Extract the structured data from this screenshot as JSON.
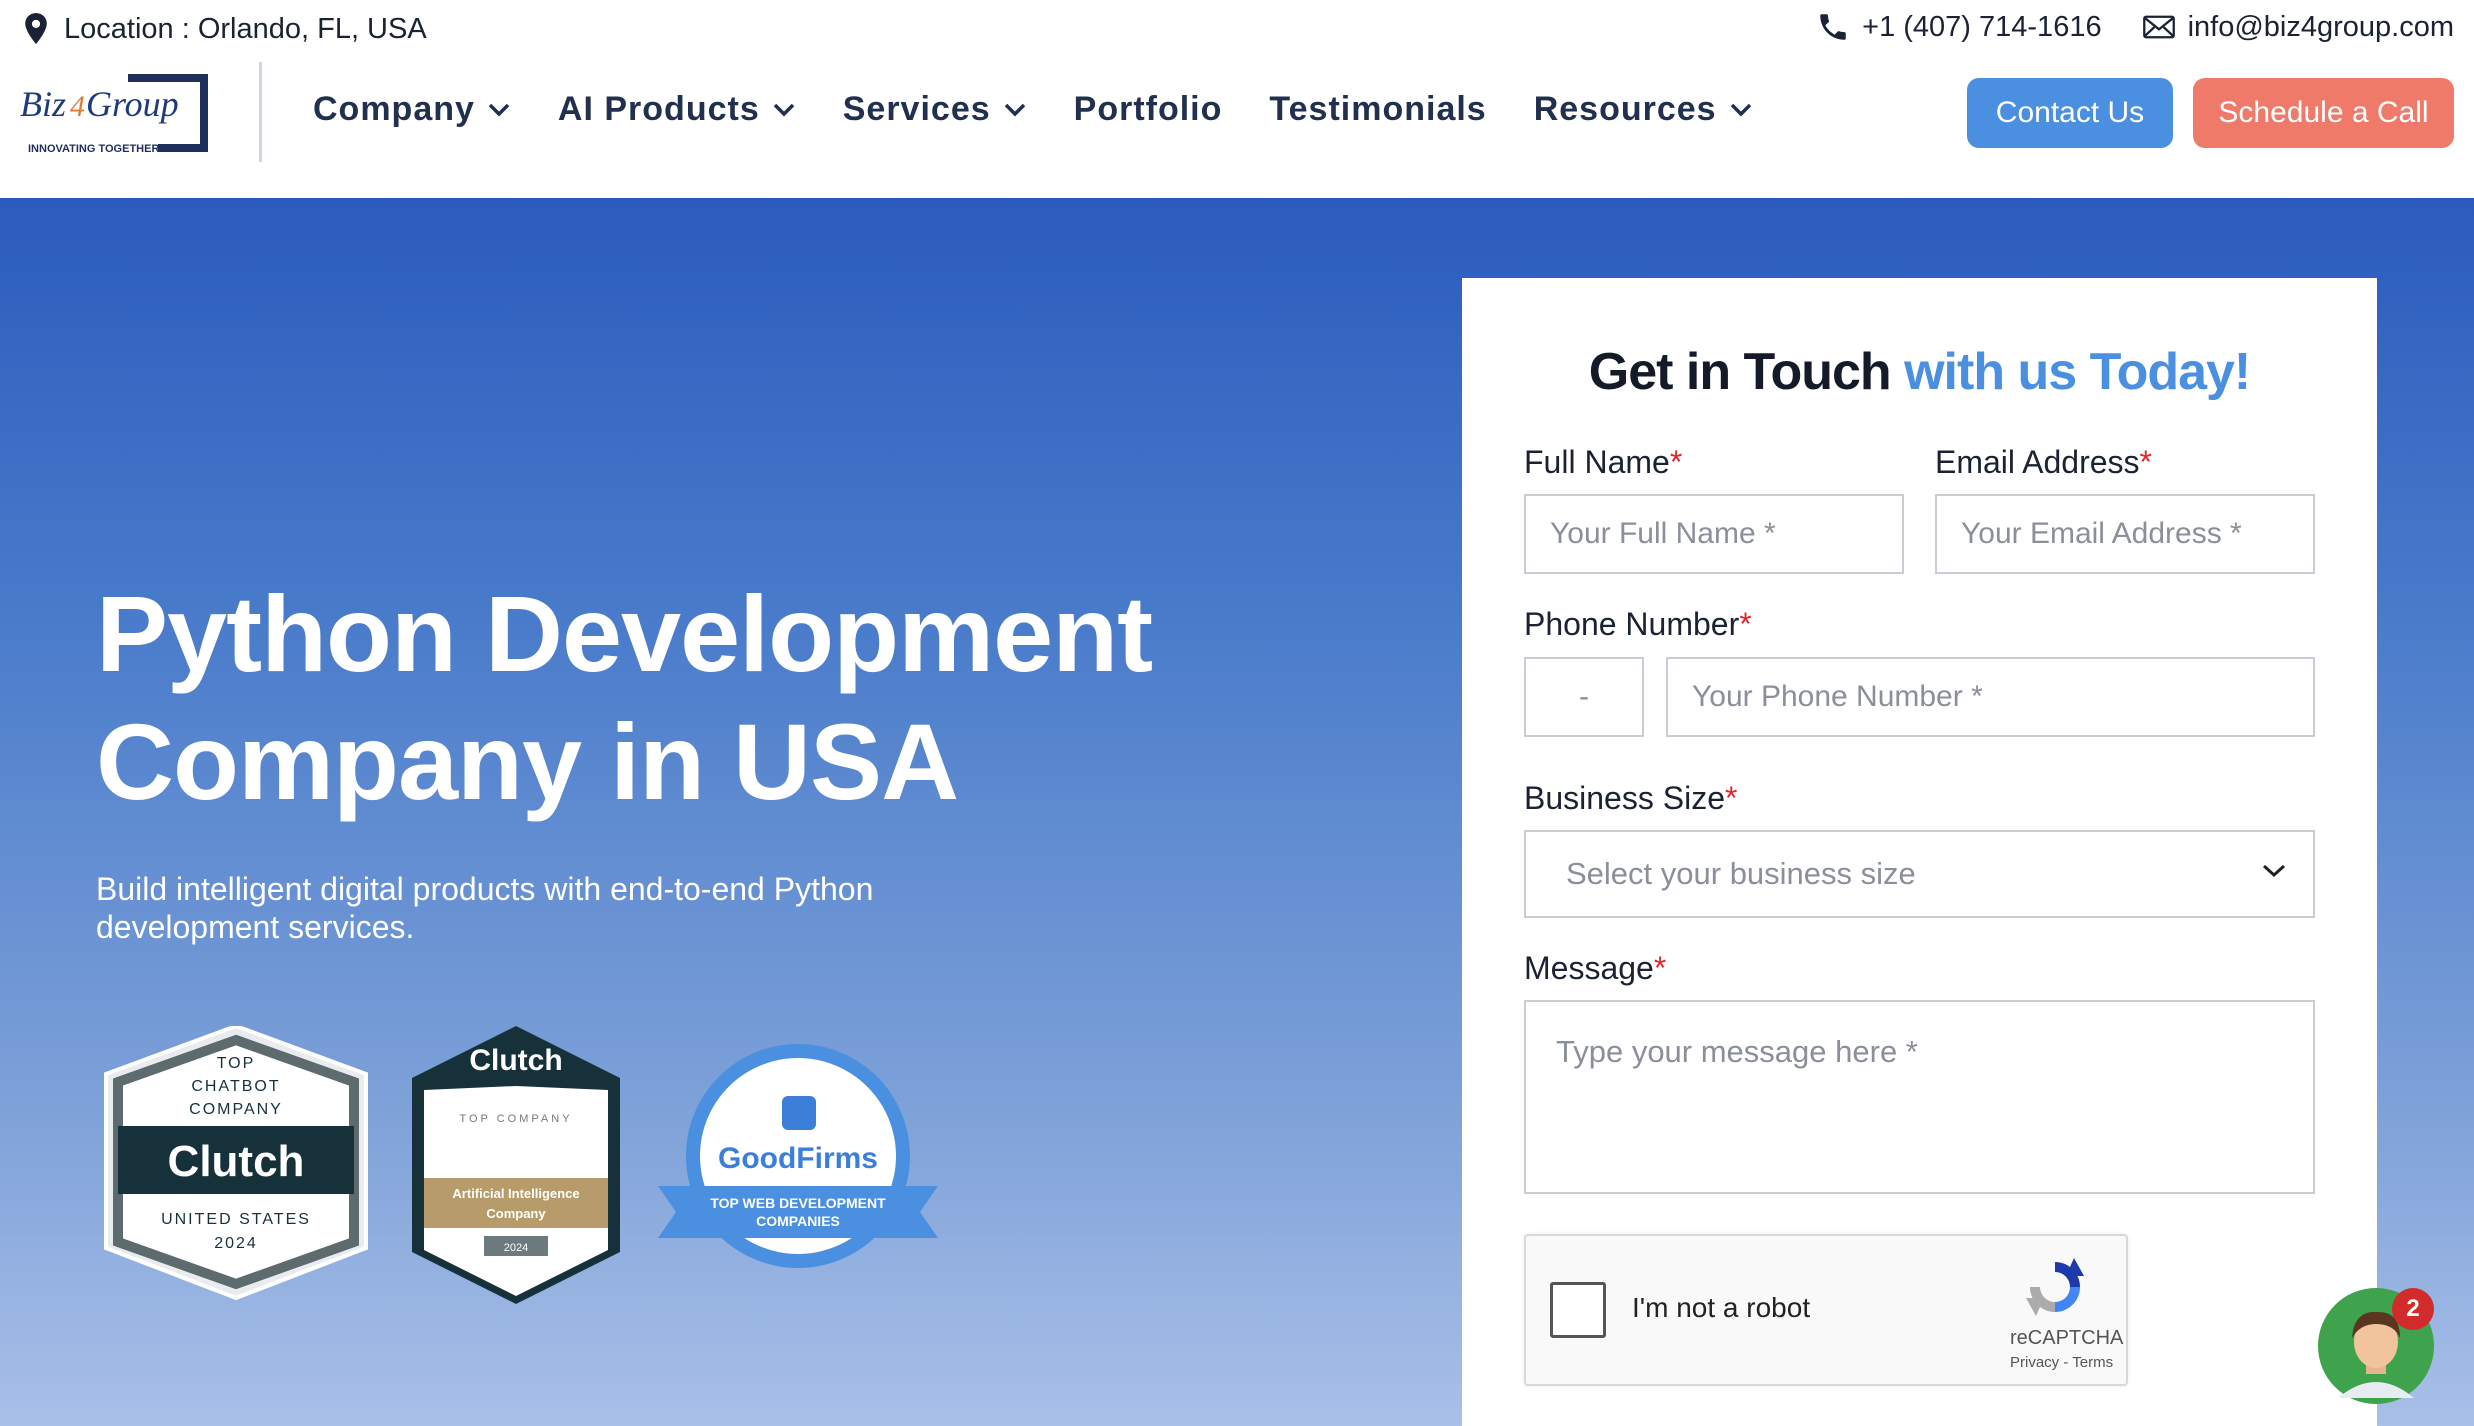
{
  "topbar": {
    "location": "Location : Orlando, FL, USA",
    "phone": "+1 (407) 714-1616",
    "email": "info@biz4group.com"
  },
  "logo": {
    "name": "Biz4Group",
    "tagline": "INNOVATING TOGETHER"
  },
  "nav": {
    "items": [
      {
        "label": "Company",
        "dropdown": true
      },
      {
        "label": "AI Products",
        "dropdown": true
      },
      {
        "label": "Services",
        "dropdown": true
      },
      {
        "label": "Portfolio",
        "dropdown": false
      },
      {
        "label": "Testimonials",
        "dropdown": false
      },
      {
        "label": "Resources",
        "dropdown": true
      }
    ],
    "contact_button": "Contact Us",
    "schedule_button": "Schedule a Call"
  },
  "hero": {
    "title_line1": "Python Development",
    "title_line2": "Company in USA",
    "subtitle": "Build intelligent digital products with end-to-end Python development services."
  },
  "badges": {
    "clutch_chatbot": {
      "top": "TOP",
      "line2": "CHATBOT",
      "line3": "COMPANY",
      "brand": "Clutch",
      "region": "UNITED STATES",
      "year": "2024"
    },
    "clutch_ai": {
      "brand": "Clutch",
      "top": "TOP COMPANY",
      "category": "Artificial Intelligence",
      "category2": "Company",
      "year": "2024"
    },
    "goodfirms": {
      "brand": "GoodFirms",
      "ribbon1": "TOP WEB DEVELOPMENT",
      "ribbon2": "COMPANIES"
    }
  },
  "form": {
    "heading_plain": "Get in Touch ",
    "heading_highlight": "with us Today!",
    "full_name_label": "Full Name",
    "full_name_placeholder": "Your Full Name *",
    "email_label": "Email Address",
    "email_placeholder": "Your Email Address *",
    "phone_label": "Phone Number",
    "phone_code": "-",
    "phone_placeholder": "Your Phone Number *",
    "business_label": "Business Size",
    "business_placeholder": "Select your business size",
    "message_label": "Message",
    "message_placeholder": "Type your message here *",
    "required_mark": "*"
  },
  "captcha": {
    "label": "I'm not a robot",
    "brand": "reCAPTCHA",
    "links": "Privacy - Terms"
  },
  "chat": {
    "badge_count": "2"
  },
  "colors": {
    "accent_blue": "#4b8fe0",
    "accent_coral": "#f07a6a",
    "hero_top": "#2a5bbd",
    "hero_bottom": "#a9c0e8",
    "required_red": "#e0252b"
  }
}
